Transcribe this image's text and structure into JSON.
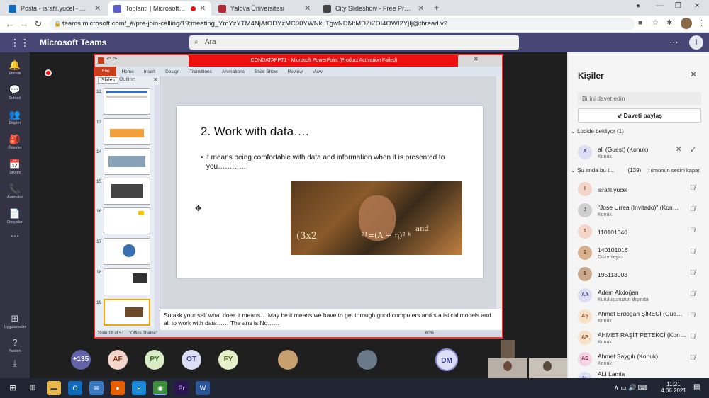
{
  "browser": {
    "tabs": [
      {
        "title": "Posta - israfil.yucel - Outlook",
        "color": "#0f6cbd"
      },
      {
        "title": "Toplantı | Microsoft Teams",
        "color": "#5b5fc7"
      },
      {
        "title": "Yalova Üniversitesi",
        "color": "#b02a37"
      },
      {
        "title": "City Slideshow - Free Premiere P",
        "color": "#444444"
      }
    ],
    "url": "teams.microsoft.com/_#/pre-join-calling/19:meeting_YmYzYTM4NjAtODYzMC00YWNkLTgwNDMtMDZiZDI4OWI2YjIj@thread.v2"
  },
  "teams": {
    "app_name": "Microsoft Teams",
    "search_placeholder": "Ara",
    "rail": [
      {
        "label": "Etkinlik",
        "icon": "bell-icon",
        "glyph": "🔔"
      },
      {
        "label": "Sohbet",
        "icon": "chat-icon",
        "glyph": "💬"
      },
      {
        "label": "Ekipler",
        "icon": "teams-icon",
        "glyph": "👥"
      },
      {
        "label": "Ödevler",
        "icon": "assignments-icon",
        "glyph": "🎒"
      },
      {
        "label": "Takvim",
        "icon": "calendar-icon",
        "glyph": "📅"
      },
      {
        "label": "Aramalar",
        "icon": "phone-icon",
        "glyph": "📞"
      },
      {
        "label": "Dosyalar",
        "icon": "files-icon",
        "glyph": "📄"
      }
    ],
    "rail_bottom": [
      {
        "label": "Uygulamalar",
        "icon": "apps-icon",
        "glyph": "⊞"
      },
      {
        "label": "Yardım",
        "icon": "help-icon",
        "glyph": "?"
      }
    ]
  },
  "ppt": {
    "window_title": "ICONDATAPPT1 - Microsoft PowerPoint (Product Activation Failed)",
    "ribbon": [
      "File",
      "Home",
      "Insert",
      "Design",
      "Transitions",
      "Animations",
      "Slide Show",
      "Review",
      "View"
    ],
    "pane_tabs": [
      "Slides",
      "Outline"
    ],
    "thumb_numbers": [
      "12",
      "13",
      "14",
      "15",
      "16",
      "17",
      "18",
      "19"
    ],
    "slide_title": "2. Work with data….",
    "slide_bullet": "It means being comfortable with data and information when it is presented to you…………",
    "notes": "So ask your self what does it means… May be it means we have to get through good computers and statistical models and all to work with data…… The ans is No……",
    "status_slide": "Slide 19 of 51",
    "status_theme": "\"Office Theme\"",
    "zoom": "60%"
  },
  "participants_row": [
    {
      "label": "+135",
      "bg": "#6264a7",
      "fg": "#ffffff"
    },
    {
      "label": "AF",
      "bg": "#f3d5c9",
      "fg": "#8a3b1f"
    },
    {
      "label": "PY",
      "bg": "#d9ecc7",
      "fg": "#3d6b1f"
    },
    {
      "label": "OT",
      "bg": "#dcdff3",
      "fg": "#3a3f8f"
    },
    {
      "label": "FY",
      "bg": "#e6efc9",
      "fg": "#56661e"
    },
    {
      "label": "DM",
      "bg": "#dcdff3",
      "fg": "#3a3f8f"
    }
  ],
  "panel": {
    "title": "Kişiler",
    "invite_placeholder": "Birini davet edin",
    "share_label": "Daveti paylaş",
    "lobby_label": "Lobide bekliyor",
    "lobby_count": "(1)",
    "lobby_person": {
      "initial": "A",
      "name": "ali (Guest) (Konuk)",
      "role": "Konuk"
    },
    "inmeeting_label": "Şu anda bu t…",
    "inmeeting_count": "(139)",
    "mute_all": "Tümünün sesini kapat",
    "people": [
      {
        "initial": "I",
        "name": "israfil.yucel",
        "role": "",
        "bg": "#f3d5c9"
      },
      {
        "initial": "J",
        "name": "\"Jose Urrea (Invitado)\" (Kon…",
        "role": "Konuk",
        "bg": "#cfcfcf"
      },
      {
        "initial": "1",
        "name": "110101040",
        "role": "",
        "bg": "#f3d5c9"
      },
      {
        "initial": "1",
        "name": "140101016",
        "role": "Düzenleyici",
        "bg": "#d8b08c"
      },
      {
        "initial": "1",
        "name": "195113003",
        "role": "",
        "bg": "#c9a88c"
      },
      {
        "initial": "AA",
        "name": "Adem Akdoğan",
        "role": "Kuruluşunuzun dışında",
        "bg": "#dcdff3"
      },
      {
        "initial": "AŞ",
        "name": "Ahmet Erdoğan ŞİRECİ (Gue…",
        "role": "Konuk",
        "bg": "#f8e1c9"
      },
      {
        "initial": "AP",
        "name": "AHMET RAŞİT PETEKCİ (Kon…",
        "role": "Konuk",
        "bg": "#f8e1c9"
      },
      {
        "initial": "AS",
        "name": "Ahmet Saygılı (Konuk)",
        "role": "Konuk",
        "bg": "#f3d5e3"
      },
      {
        "initial": "AL",
        "name": "ALI Lamia",
        "role": "",
        "bg": "#dcdff3"
      }
    ]
  },
  "taskbar": {
    "time": "11:21",
    "date": "4.06.2021",
    "apps": [
      {
        "label": "O",
        "color": "#0f6cbd",
        "icon": "outlook-icon"
      },
      {
        "label": "✉",
        "color": "#3a78c2",
        "icon": "mail-icon"
      },
      {
        "label": "●",
        "color": "#e66000",
        "icon": "firefox-icon"
      },
      {
        "label": "e",
        "color": "#1a8adb",
        "icon": "edge-icon"
      },
      {
        "label": "◉",
        "color": "#3d8f3d",
        "icon": "chrome-icon"
      },
      {
        "label": "Pr",
        "color": "#2a1650",
        "icon": "premiere-icon"
      },
      {
        "label": "W",
        "color": "#2b579a",
        "icon": "word-icon"
      }
    ]
  }
}
